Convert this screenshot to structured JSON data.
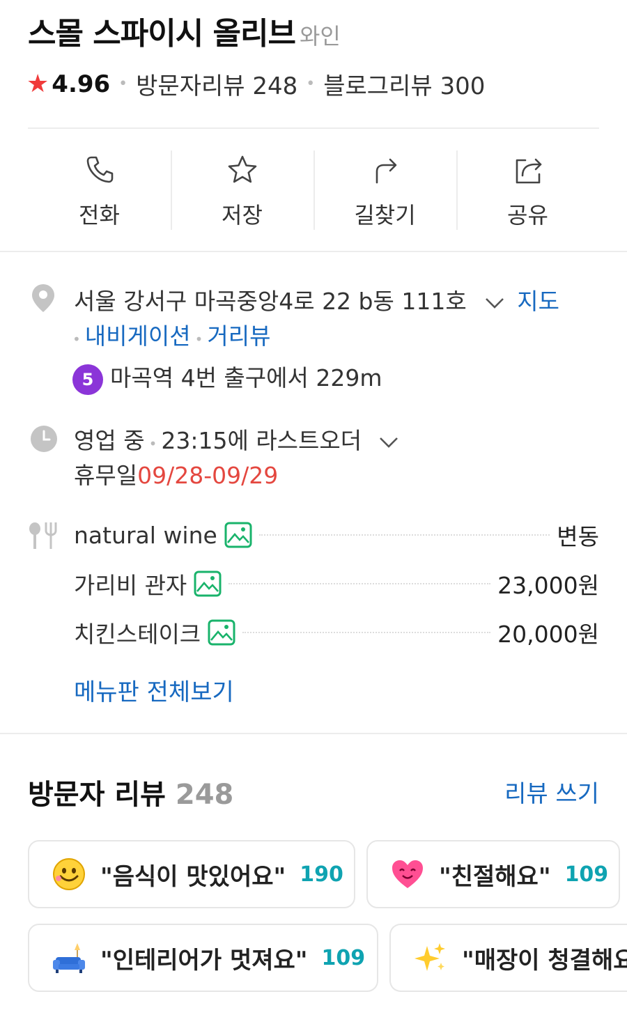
{
  "header": {
    "name": "스몰 스파이시 올리브",
    "category": "와인",
    "rating": "4.96",
    "visitor_reviews": "방문자리뷰 248",
    "blog_reviews": "블로그리뷰 300"
  },
  "actions": [
    {
      "label": "전화",
      "icon": "phone-icon"
    },
    {
      "label": "저장",
      "icon": "star-outline-icon"
    },
    {
      "label": "길찾기",
      "icon": "directions-icon"
    },
    {
      "label": "공유",
      "icon": "share-icon"
    }
  ],
  "address": {
    "text": "서울 강서구 마곡중앙4로 22 b동 111호",
    "map_link": "지도",
    "navigation_link": "내비게이션",
    "streetview_link": "거리뷰",
    "subway_line": "5",
    "subway_color": "#8b35d8",
    "subway_text": "마곡역 4번 출구에서 229m"
  },
  "hours": {
    "status": "영업 중",
    "last_order": "23:15에 라스트오더",
    "holiday_label": "휴무일",
    "holiday_dates": "09/28-09/29"
  },
  "menu": {
    "items": [
      {
        "name": "natural wine",
        "price": "변동"
      },
      {
        "name": "가리비 관자",
        "price": "23,000원"
      },
      {
        "name": "치킨스테이크",
        "price": "20,000원"
      }
    ],
    "view_all": "메뉴판 전체보기"
  },
  "reviews": {
    "title": "방문자 리뷰",
    "count": "248",
    "write": "리뷰 쓰기",
    "keywords": [
      {
        "text": "\"음식이 맛있어요\"",
        "count": "190",
        "icon": "smiley-face-icon"
      },
      {
        "text": "\"친절해요\"",
        "count": "109",
        "icon": "heart-face-icon"
      },
      {
        "text": "\"인테리어가 멋져요\"",
        "count": "109",
        "icon": "sofa-icon"
      },
      {
        "text": "\"매장이 청결해요\"",
        "count": "",
        "icon": "sparkles-icon"
      }
    ]
  },
  "colors": {
    "accent_link": "#1769c0",
    "star": "#f03b3b",
    "holiday_red": "#e4473f",
    "keyword_count": "#0fa3b1",
    "menu_photo_green": "#19b36b"
  }
}
